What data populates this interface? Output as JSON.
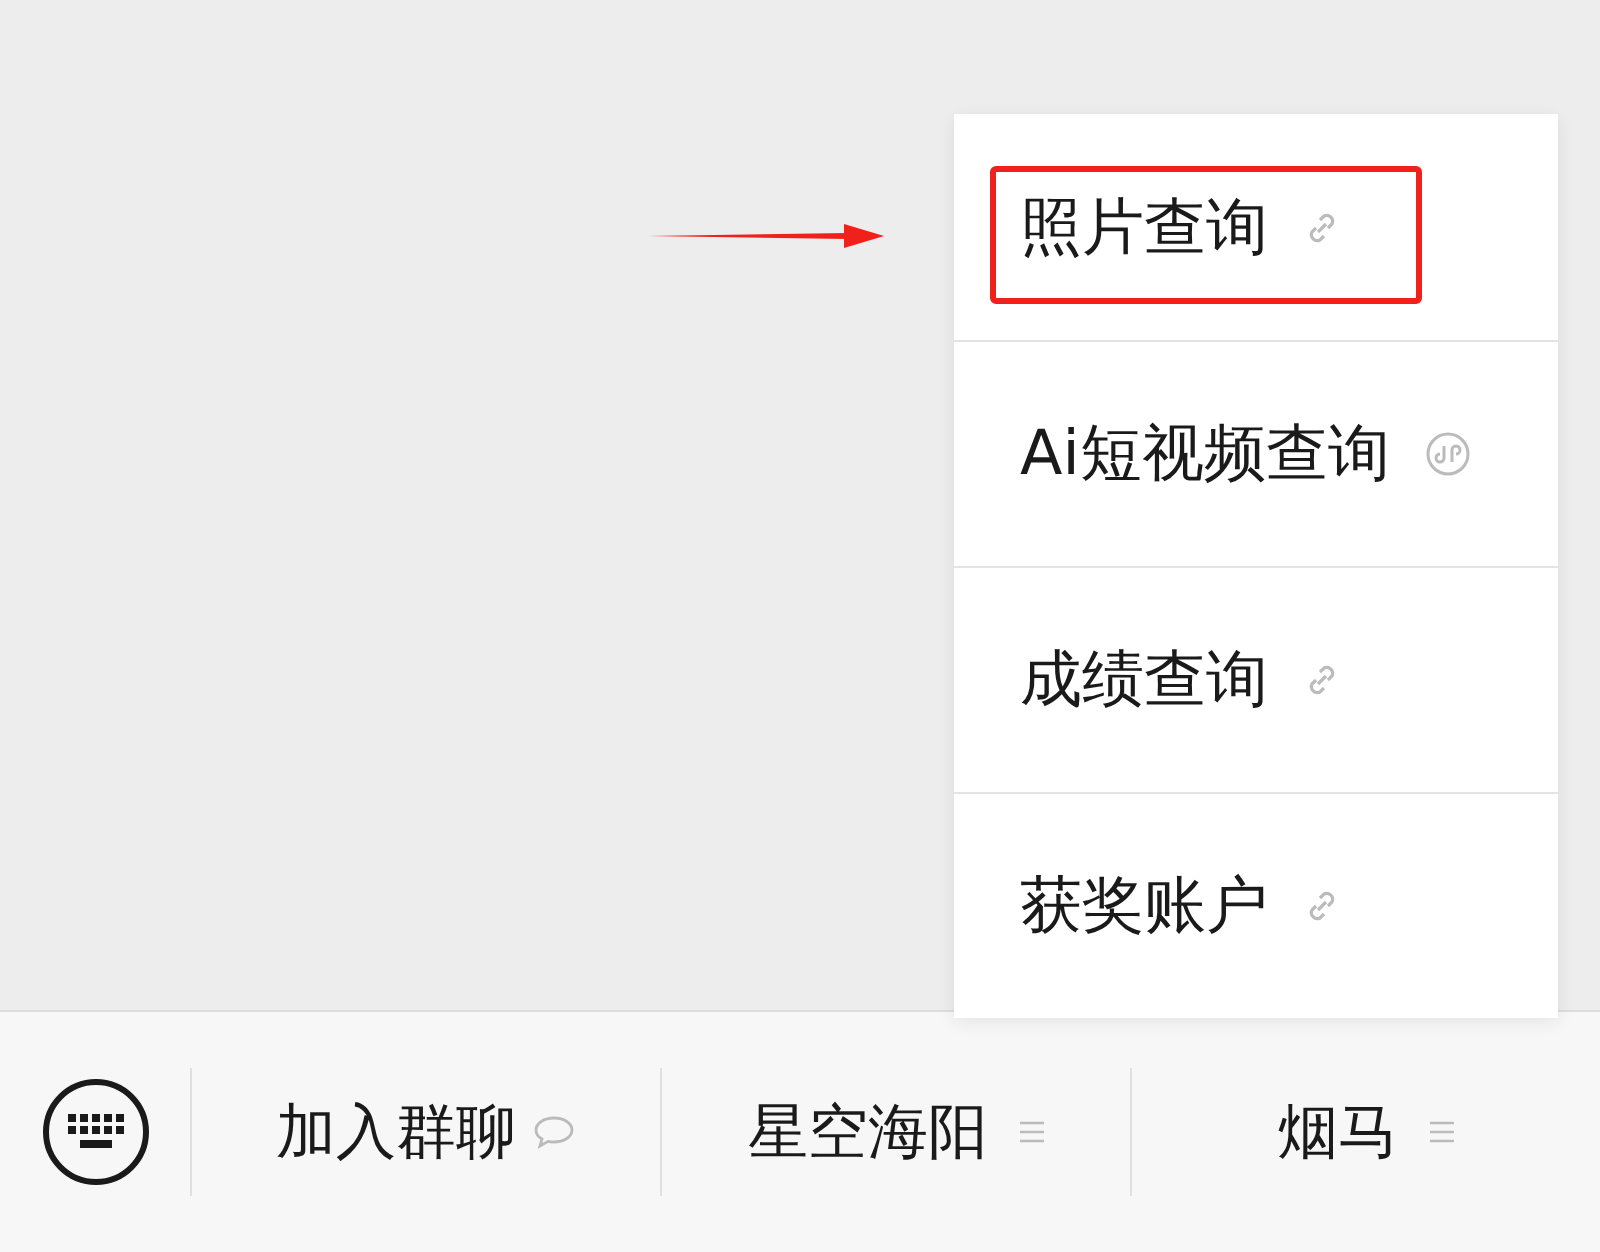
{
  "popup_menu": {
    "items": [
      {
        "label": "照片查询",
        "kind": "link",
        "highlighted": true
      },
      {
        "label": "Ai短视频查询",
        "kind": "miniprogram",
        "highlighted": false
      },
      {
        "label": "成绩查询",
        "kind": "link",
        "highlighted": false
      },
      {
        "label": "获奖账户",
        "kind": "link",
        "highlighted": false
      }
    ]
  },
  "bottom_menu": {
    "items": [
      {
        "label": "加入群聊",
        "kind": "chat"
      },
      {
        "label": "星空海阳",
        "kind": "submenu"
      },
      {
        "label": "烟马",
        "kind": "submenu"
      }
    ]
  }
}
